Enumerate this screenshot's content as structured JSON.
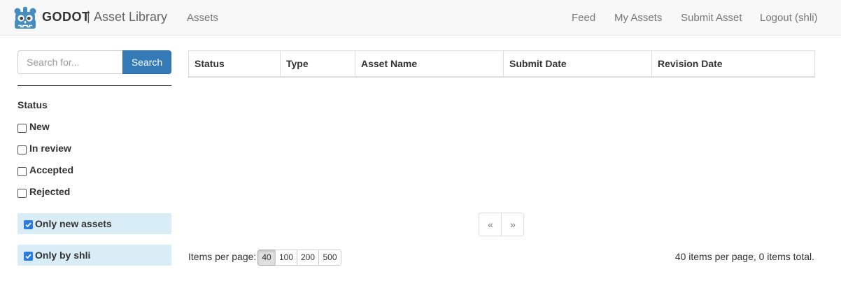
{
  "header": {
    "brand": "GODOT",
    "separator": "|",
    "subtitle": "Asset Library",
    "nav_left": [
      "Assets"
    ],
    "nav_right": [
      "Feed",
      "My Assets",
      "Submit Asset",
      "Logout (shli)"
    ],
    "logo_icon": "godot-robot-logo-icon",
    "logo_color": "#478cbf"
  },
  "search": {
    "placeholder": "Search for...",
    "value": "",
    "button_label": "Search"
  },
  "filters": {
    "status_heading": "Status",
    "status_options": [
      {
        "label": "New",
        "checked": false
      },
      {
        "label": "In review",
        "checked": false
      },
      {
        "label": "Accepted",
        "checked": false
      },
      {
        "label": "Rejected",
        "checked": false
      }
    ],
    "toggles": [
      {
        "label": "Only new assets",
        "checked": true
      },
      {
        "label": "Only by shli",
        "checked": true
      }
    ]
  },
  "table": {
    "columns": [
      "Status",
      "Type",
      "Asset Name",
      "Submit Date",
      "Revision Date"
    ],
    "rows": []
  },
  "pagination": {
    "prev": "«",
    "next": "»"
  },
  "items_per_page": {
    "label": "Items per page:",
    "options": [
      "40",
      "100",
      "200",
      "500"
    ],
    "selected": "40",
    "summary": "40 items per page, 0 items total."
  },
  "colors": {
    "primary": "#337ab7",
    "toggle_bg": "#d9edf7",
    "checkbox_checked": "#2a7ae2",
    "navbar_bg": "#f8f8f8"
  }
}
